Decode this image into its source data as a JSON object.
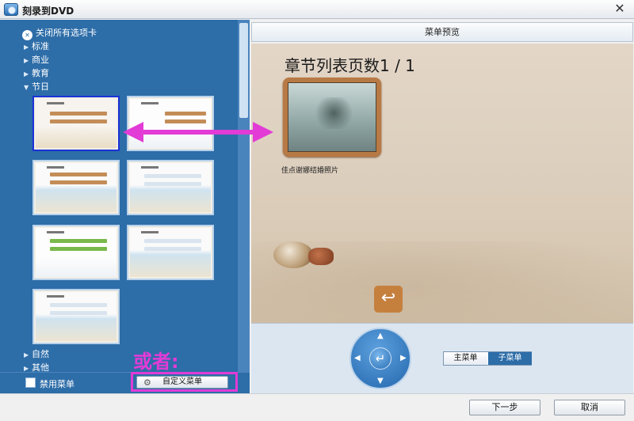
{
  "window": {
    "title": "刻录到DVD"
  },
  "sidebar": {
    "close_all_label": "关闭所有选项卡",
    "categories_top": [
      {
        "label": "标准",
        "expanded": false
      },
      {
        "label": "商业",
        "expanded": false
      },
      {
        "label": "教育",
        "expanded": false
      },
      {
        "label": "节日",
        "expanded": true
      }
    ],
    "categories_bottom": [
      {
        "label": "自然"
      },
      {
        "label": "其他"
      }
    ],
    "disable_menu_label": "禁用菜单",
    "custom_menu_label": "自定义菜单"
  },
  "annotation": {
    "or_text": "或者:",
    "color": "#e23bd6"
  },
  "preview": {
    "header": "菜单预览",
    "page_title": "章节列表页数1 / 1",
    "chapter_label": "佳点谢娜结婚照片"
  },
  "nav": {
    "main_menu_label": "主菜单",
    "sub_menu_label": "子菜单",
    "active": "子菜单"
  },
  "footer": {
    "next_label": "下一步",
    "cancel_label": "取消"
  },
  "colors": {
    "sidebar_bg": "#2d6da8",
    "selected_border": "#1a33d6",
    "frame": "#b87a45"
  }
}
